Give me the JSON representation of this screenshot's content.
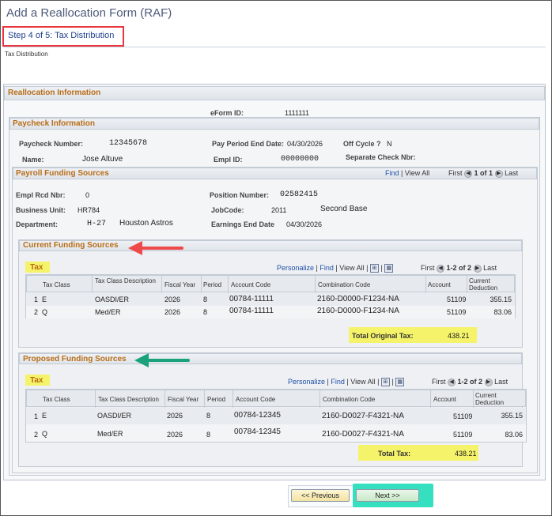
{
  "page": {
    "title": "Add a Reallocation Form (RAF)",
    "step": "Step 4 of 5: Tax Distribution",
    "subtitle": "Tax Distribution"
  },
  "reallocation": {
    "title": "Reallocation Information",
    "eform_id_label": "eForm ID:",
    "eform_id": "1111111"
  },
  "paycheck": {
    "title": "Paycheck Information",
    "paycheck_number_label": "Paycheck Number:",
    "paycheck_number": "12345678",
    "pay_period_end_label": "Pay Period End Date:",
    "pay_period_end": "04/30/2026",
    "off_cycle_label": "Off Cycle ?",
    "off_cycle": "N",
    "name_label": "Name:",
    "name": "Jose Altuve",
    "empl_id_label": "Empl ID:",
    "empl_id": "00000000",
    "separate_check_label": "Separate Check Nbr:"
  },
  "payroll": {
    "title": "Payroll Funding Sources",
    "nav": {
      "find": "Find",
      "view_all": "View All",
      "first": "First",
      "range": "1 of 1",
      "last": "Last"
    },
    "empl_rcd_label": "Empl Rcd Nbr:",
    "empl_rcd": "0",
    "position_number_label": "Position Number:",
    "position_number": "02582415",
    "business_unit_label": "Business Unit:",
    "business_unit": "HR784",
    "jobcode_label": "JobCode:",
    "jobcode": "2011",
    "jobcode_desc": "Second Base",
    "department_label": "Department:",
    "department": "H-27",
    "department_desc": "Houston Astros",
    "earnings_end_label": "Earnings End Date",
    "earnings_end": "04/30/2026"
  },
  "current": {
    "title": "Current Funding Sources",
    "tax_label": "Tax",
    "nav": {
      "personalize": "Personalize",
      "find": "Find",
      "view_all": "View All",
      "first": "First",
      "range": "1-2 of 2",
      "last": "Last"
    },
    "columns": [
      "Tax Class",
      "Tax Class Description",
      "Fiscal Year",
      "Period",
      "Account Code",
      "Combination Code",
      "Account",
      "Current Deduction"
    ],
    "rows": [
      {
        "num": "1",
        "tax_class": "E",
        "desc": "OASDI/ER",
        "fy": "2026",
        "period": "8",
        "account_code": "00784-11111",
        "combination": "2160-D0000-F1234-NA",
        "account": "51109",
        "deduction": "355.15"
      },
      {
        "num": "2",
        "tax_class": "Q",
        "desc": "Med/ER",
        "fy": "2026",
        "period": "8",
        "account_code": "00784-11111",
        "combination": "2160-D0000-F1234-NA",
        "account": "51109",
        "deduction": "83.06"
      }
    ],
    "total_label": "Total Original Tax:",
    "total": "438.21"
  },
  "proposed": {
    "title": "Proposed Funding Sources",
    "tax_label": "Tax",
    "nav": {
      "personalize": "Personalize",
      "find": "Find",
      "view_all": "View All",
      "first": "First",
      "range": "1-2 of 2",
      "last": "Last"
    },
    "columns": [
      "Tax Class",
      "Tax Class Description",
      "Fiscal Year",
      "Period",
      "Account Code",
      "Combination Code",
      "Account",
      "Current Deduction"
    ],
    "rows": [
      {
        "num": "1",
        "tax_class": "E",
        "desc": "OASDI/ER",
        "fy": "2026",
        "period": "8",
        "account_code": "00784-12345",
        "combination": "2160-D0027-F4321-NA",
        "account": "51109",
        "deduction": "355.15"
      },
      {
        "num": "2",
        "tax_class": "Q",
        "desc": "Med/ER",
        "fy": "2026",
        "period": "8",
        "account_code": "00784-12345",
        "combination": "2160-D0027-F4321-NA",
        "account": "51109",
        "deduction": "83.06"
      }
    ],
    "total_label": "Total Tax:",
    "total": "438.21"
  },
  "buttons": {
    "previous": "<< Previous",
    "next": "Next >>"
  },
  "colors": {
    "highlight_yellow": "#f5f36a",
    "step_box_red": "#e8363f",
    "arrow_red": "#ef4a4a",
    "arrow_green": "#1aa37a",
    "next_highlight": "#34e0c0",
    "section_title": "#b96d16",
    "link_blue": "#1f4fa8"
  },
  "icons": {
    "prev_nav": "circle-left-arrow-icon",
    "next_nav": "circle-right-arrow-icon",
    "zoom": "zoom-grid-icon",
    "download": "download-grid-icon"
  }
}
